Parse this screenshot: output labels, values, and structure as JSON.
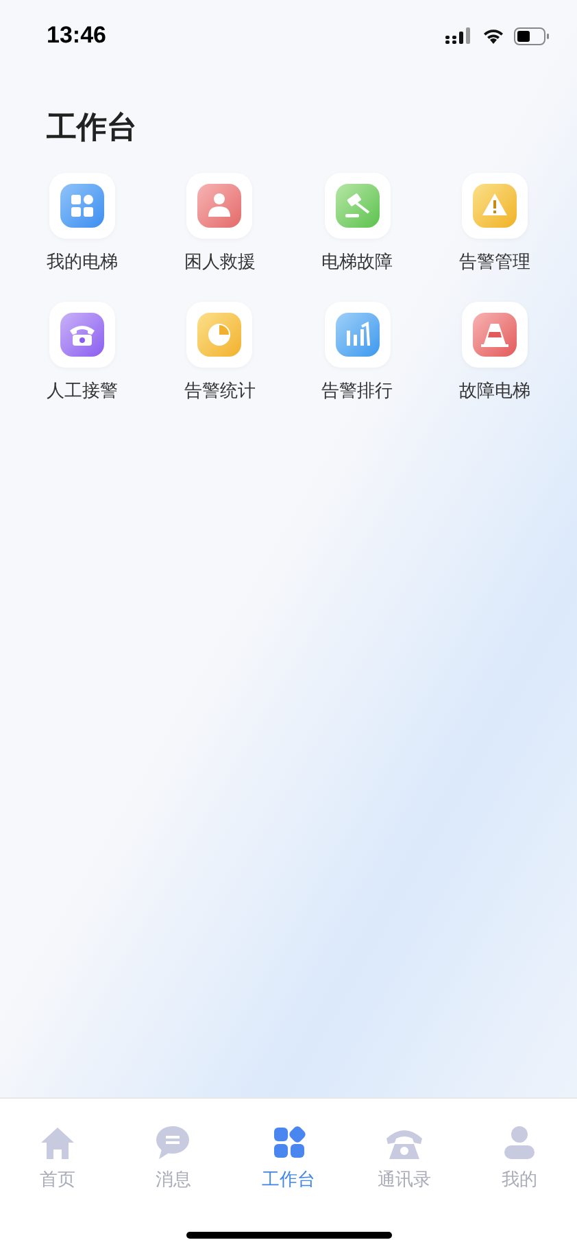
{
  "status_bar": {
    "time": "13:46"
  },
  "page_title": "工作台",
  "apps": [
    {
      "label": "我的电梯"
    },
    {
      "label": "困人救援"
    },
    {
      "label": "电梯故障"
    },
    {
      "label": "告警管理"
    },
    {
      "label": "人工接警"
    },
    {
      "label": "告警统计"
    },
    {
      "label": "告警排行"
    },
    {
      "label": "故障电梯"
    }
  ],
  "tab_bar": [
    {
      "label": "首页",
      "selected": false
    },
    {
      "label": "消息",
      "selected": false
    },
    {
      "label": "工作台",
      "selected": true
    },
    {
      "label": "通讯录",
      "selected": false
    },
    {
      "label": "我的",
      "selected": false
    }
  ]
}
